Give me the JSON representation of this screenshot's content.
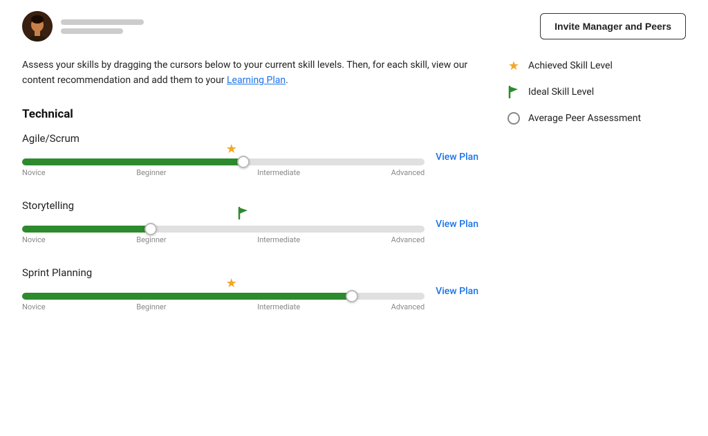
{
  "header": {
    "invite_button_label": "Invite Manager and Peers"
  },
  "description": {
    "text_1": "Assess your skills by dragging the cursors below to your current skill levels. Then, for each skill, view our content recommendation and add them to your ",
    "link_text": "Learning Plan",
    "text_2": "."
  },
  "legend": {
    "items": [
      {
        "id": "achieved",
        "label": "Achieved Skill Level",
        "icon_type": "star"
      },
      {
        "id": "ideal",
        "label": "Ideal Skill Level",
        "icon_type": "flag"
      },
      {
        "id": "peer",
        "label": "Average Peer Assessment",
        "icon_type": "circle"
      }
    ]
  },
  "sections": [
    {
      "title": "Technical",
      "skills": [
        {
          "name": "Agile/Scrum",
          "fill_pct": 55,
          "thumb_pct": 55,
          "marker_pct": 52,
          "marker_type": "star",
          "view_plan_label": "View Plan",
          "labels": [
            "Novice",
            "Beginner",
            "Intermediate",
            "Advanced"
          ]
        },
        {
          "name": "Storytelling",
          "fill_pct": 32,
          "thumb_pct": 32,
          "marker_pct": 55,
          "marker_type": "flag",
          "view_plan_label": "View Plan",
          "labels": [
            "Novice",
            "Beginner",
            "Intermediate",
            "Advanced"
          ]
        },
        {
          "name": "Sprint Planning",
          "fill_pct": 82,
          "thumb_pct": 82,
          "marker_pct": 52,
          "marker_type": "star",
          "view_plan_label": "View Plan",
          "labels": [
            "Novice",
            "Beginner",
            "Intermediate",
            "Advanced"
          ]
        }
      ]
    }
  ]
}
